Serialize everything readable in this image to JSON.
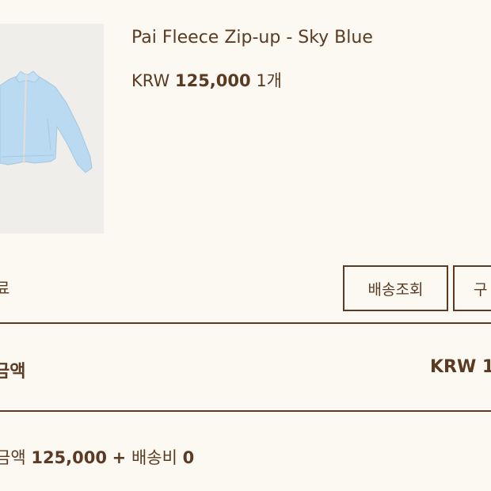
{
  "product": {
    "name": "Pai Fleece Zip-up - Sky Blue",
    "currency": "KRW",
    "price": "125,000",
    "quantity": "1개",
    "image_icon": "jacket-icon"
  },
  "order": {
    "status_label": "료"
  },
  "buttons": {
    "delivery_tracking": "배송조회",
    "purchase_partial": "구"
  },
  "totals": {
    "label_partial": "금액",
    "value_partial": "KRW 1"
  },
  "summary": {
    "label_partial": "금액",
    "amount": "125,000",
    "plus": "+",
    "shipping_label": "배송비",
    "shipping_amount": "0"
  },
  "colors": {
    "background": "#fcf9f2",
    "text": "#5a3a22",
    "jacket": "#b9daf0"
  }
}
